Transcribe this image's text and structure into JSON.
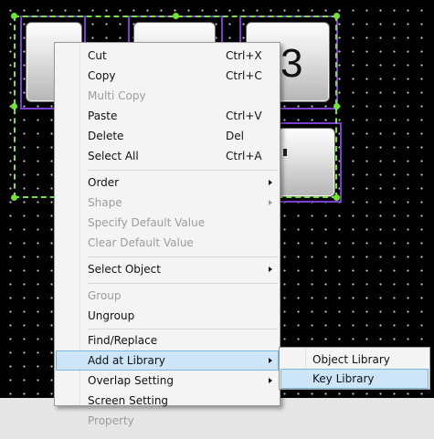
{
  "screen": {
    "key_label": "3",
    "colors": {
      "background": "#000000",
      "grid_dot": "#c8c8c8",
      "selection": "#77e33b",
      "object_frame": "#7a3fd0",
      "menu_bg": "#f4f4f4",
      "menu_highlight": "#cce6f7"
    }
  },
  "context_menu": {
    "items": [
      {
        "label": "Cut",
        "shortcut": "Ctrl+X"
      },
      {
        "label": "Copy",
        "shortcut": "Ctrl+C"
      },
      {
        "label": "Multi Copy",
        "shortcut": ""
      },
      {
        "label": "Paste",
        "shortcut": "Ctrl+V"
      },
      {
        "label": "Delete",
        "shortcut": "Del"
      },
      {
        "label": "Select All",
        "shortcut": "Ctrl+A"
      },
      {
        "label": "Order",
        "shortcut": ""
      },
      {
        "label": "Shape",
        "shortcut": ""
      },
      {
        "label": "Specify Default Value",
        "shortcut": ""
      },
      {
        "label": "Clear Default Value",
        "shortcut": ""
      },
      {
        "label": "Select Object",
        "shortcut": ""
      },
      {
        "label": "Group",
        "shortcut": ""
      },
      {
        "label": "Ungroup",
        "shortcut": ""
      },
      {
        "label": "Find/Replace",
        "shortcut": ""
      },
      {
        "label": "Add at Library",
        "shortcut": ""
      },
      {
        "label": "Overlap Setting",
        "shortcut": ""
      },
      {
        "label": "Screen Setting",
        "shortcut": ""
      },
      {
        "label": "Property",
        "shortcut": ""
      }
    ]
  },
  "submenu": {
    "items": [
      {
        "label": "Object Library"
      },
      {
        "label": "Key Library"
      }
    ]
  }
}
